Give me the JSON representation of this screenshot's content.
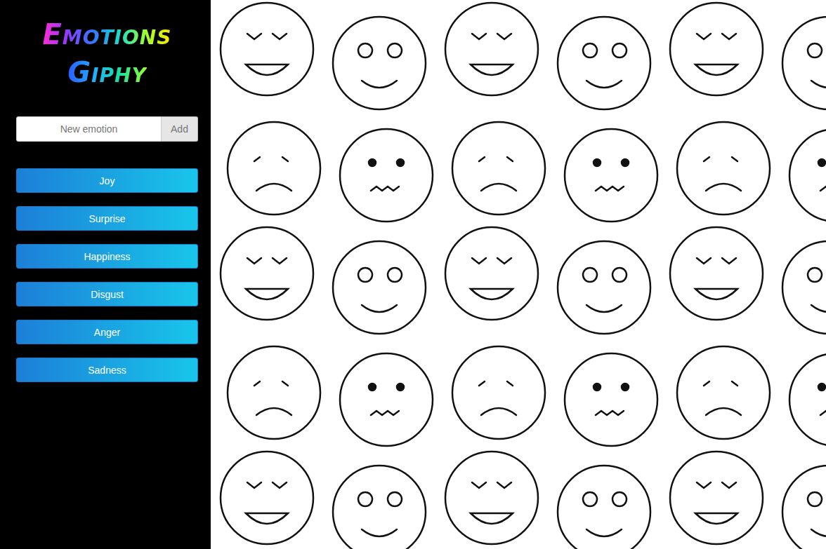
{
  "app": {
    "title_lines": [
      "Emotions",
      "Giphy"
    ]
  },
  "form": {
    "placeholder": "New emotion",
    "button": "Add"
  },
  "emotions": [
    {
      "label": "Joy"
    },
    {
      "label": "Surprise"
    },
    {
      "label": "Happiness"
    },
    {
      "label": "Disgust"
    },
    {
      "label": "Anger"
    },
    {
      "label": "Sadness"
    }
  ]
}
